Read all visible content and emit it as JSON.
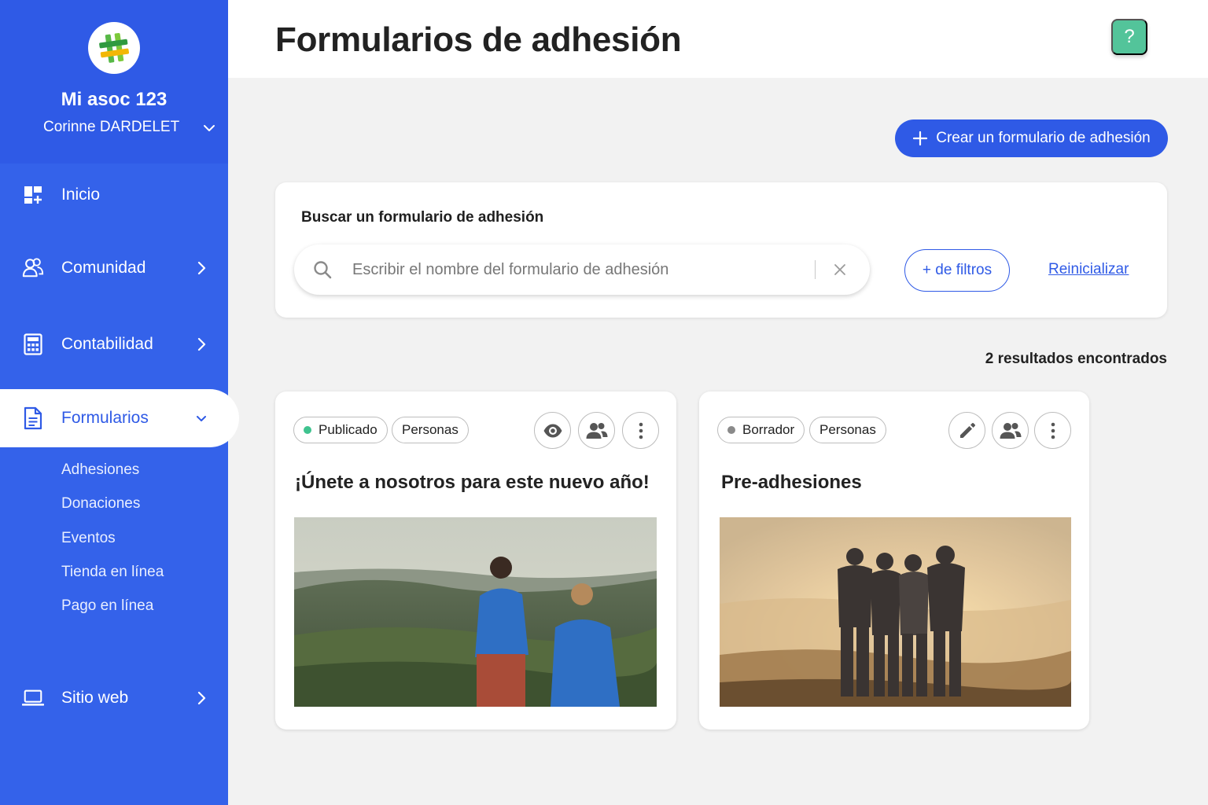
{
  "app": {
    "org_name": "Mi asoc 123",
    "user_name": "Corinne DARDELET"
  },
  "sidebar": {
    "items": [
      {
        "label": "Inicio",
        "icon": "dashboard-icon"
      },
      {
        "label": "Comunidad",
        "icon": "community-icon"
      },
      {
        "label": "Contabilidad",
        "icon": "calculator-icon"
      },
      {
        "label": "Formularios",
        "icon": "document-icon"
      },
      {
        "label": "Sitio web",
        "icon": "laptop-icon"
      }
    ],
    "subitems": [
      "Adhesiones",
      "Donaciones",
      "Eventos",
      "Tienda en línea",
      "Pago en línea"
    ]
  },
  "header": {
    "title": "Formularios de adhesión",
    "help_label": "?"
  },
  "actions": {
    "create_label": "Crear un formulario de adhesión"
  },
  "search": {
    "title": "Buscar un formulario de adhesión",
    "placeholder": "Escribir el nombre del formulario de adhesión",
    "filters_label": "+ de filtros",
    "reset_label": "Reinicializar"
  },
  "results": {
    "text": "2 resultados encontrados"
  },
  "cards": [
    {
      "status": "Publicado",
      "status_color": "#3fc38f",
      "audience": "Personas",
      "title": "¡Únete a nosotros para este nuevo año!",
      "actions": [
        "eye-icon",
        "people-icon",
        "more-vertical-icon"
      ]
    },
    {
      "status": "Borrador",
      "status_color": "#8a8a8a",
      "audience": "Personas",
      "title": "Pre-adhesiones",
      "actions": [
        "pencil-icon",
        "people-icon",
        "more-vertical-icon"
      ]
    }
  ],
  "colors": {
    "sidebar": "#3462ea",
    "primary": "#2f5ae6",
    "help": "#53c49a"
  }
}
